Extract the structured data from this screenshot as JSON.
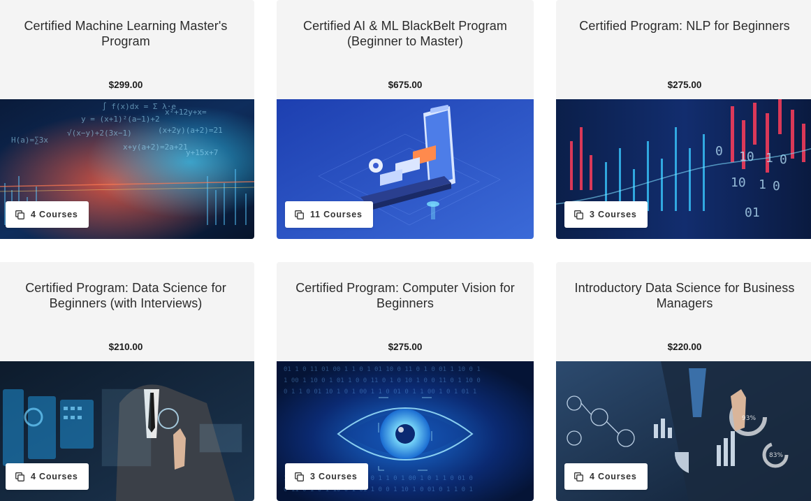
{
  "cards": [
    {
      "title": "Certified Machine Learning Master's Program",
      "price": "$299.00",
      "courses": "4 Courses",
      "image": "machine-learning-equations-image"
    },
    {
      "title": "Certified AI & ML BlackBelt Program (Beginner to Master)",
      "price": "$675.00",
      "courses": "11 Courses",
      "image": "ai-isometric-phone-image"
    },
    {
      "title": "Certified Program: NLP for Beginners",
      "price": "$275.00",
      "courses": "3 Courses",
      "image": "nlp-candlestick-binary-image"
    },
    {
      "title": "Certified Program: Data Science for Beginners (with Interviews)",
      "price": "$210.00",
      "courses": "4 Courses",
      "image": "businessman-hologram-image"
    },
    {
      "title": "Certified Program: Computer Vision for Beginners",
      "price": "$275.00",
      "courses": "3 Courses",
      "image": "digital-eye-image"
    },
    {
      "title": "Introductory Data Science for Business Managers",
      "price": "$220.00",
      "courses": "4 Courses",
      "image": "business-analytics-touch-image"
    }
  ],
  "colors": {
    "card_bg": "#f4f4f4",
    "title_text": "#2b2b2b",
    "price_text": "#1c1c1c",
    "badge_bg": "#ffffff"
  },
  "icons": {
    "badge": "copy-stack-icon"
  }
}
